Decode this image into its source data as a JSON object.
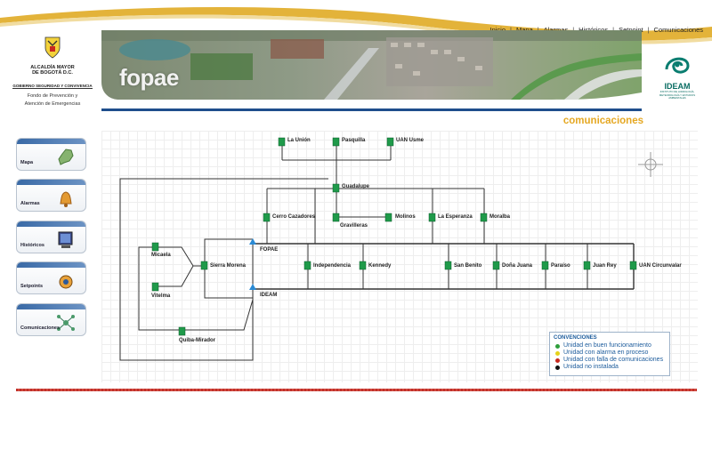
{
  "nav": {
    "items": [
      "Inicio",
      "Mapa",
      "Alarmas",
      "Históricos",
      "Setpoint",
      "Comunicaciones"
    ]
  },
  "logo_left": {
    "line1": "ALCALDÍA MAYOR",
    "line2": "DE BOGOTÁ D.C.",
    "line3": "GOBIERNO SEGURIDAD Y CONVIVENCIA",
    "line4": "Fondo de Prevención y",
    "line5": "Atención de Emergencias"
  },
  "banner": {
    "title": "fopae"
  },
  "logo_right": {
    "name": "IDEAM",
    "sub": "INSTITUTO DE HIDROLOGÍA, METEOROLOGÍA Y ESTUDIOS AMBIENTALES"
  },
  "section_title": "comunicaciones",
  "sidebar": {
    "items": [
      {
        "label": "Mapa",
        "icon": "map-icon"
      },
      {
        "label": "Alarmas",
        "icon": "bell-icon"
      },
      {
        "label": "Históricos",
        "icon": "monitor-icon"
      },
      {
        "label": "Setpoints",
        "icon": "gauge-icon"
      },
      {
        "label": "Comunicaciones",
        "icon": "network-icon"
      }
    ]
  },
  "diagram": {
    "nodes": {
      "la_union": "La Unión",
      "pasquilla": "Pasquilla",
      "uan_usme": "UAN Usme",
      "guadalupe": "Guadalupe",
      "cerro_cazadores": "Cerro Cazadores",
      "gravilleras": "Gravilleras",
      "molinos": "Molinos",
      "la_esperanza": "La Esperanza",
      "moralba": "Moralba",
      "micaela": "Micaela",
      "sierra_morena": "Sierra Morena",
      "fopae": "FOPAE",
      "ideam": "IDEAM",
      "vitelma": "Vitelma",
      "quiba_mirador": "Quiba-Mirador",
      "independencia": "Independencia",
      "kennedy": "Kennedy",
      "san_benito": "San Benito",
      "dona_juana": "Doña Juana",
      "paraiso": "Paraíso",
      "juan_rey": "Juan Rey",
      "uan_circunvalar": "UAN Circunvalar"
    }
  },
  "legend": {
    "title": "CONVENCIONES",
    "items": [
      {
        "label": "Unidad en buen funcionamiento",
        "color": "#2e9e3c"
      },
      {
        "label": "Unidad con alarma en proceso",
        "color": "#e6d21a"
      },
      {
        "label": "Unidad con falla de comunicaciones",
        "color": "#c8281e"
      },
      {
        "label": "Unidad no instalada",
        "color": "#111111"
      }
    ]
  },
  "colors": {
    "accent": "#e5a823",
    "nav_blue": "#1f4e8c",
    "unit_green": "#1f9a4a"
  }
}
